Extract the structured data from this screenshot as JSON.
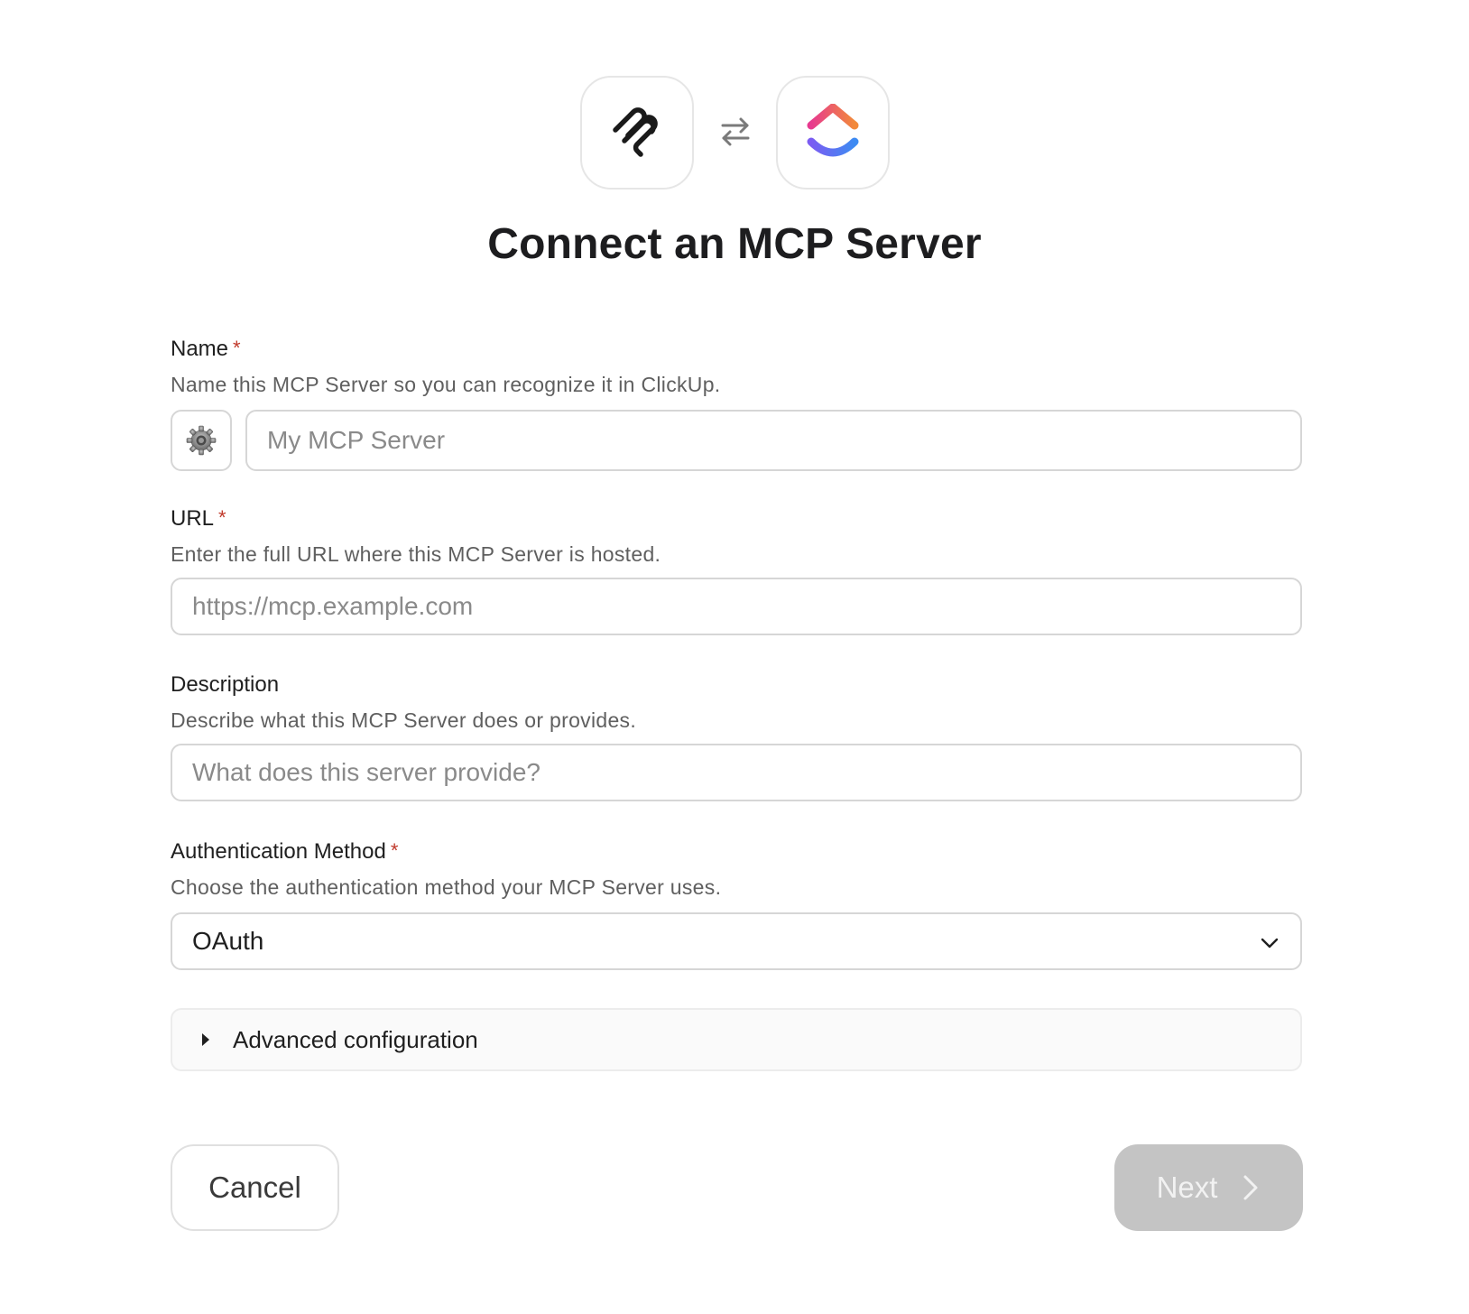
{
  "header": {
    "title": "Connect an MCP Server",
    "left_logo_icon": "mcp-logo-icon",
    "swap_icon": "swap-arrows-icon",
    "right_logo_icon": "clickup-logo-icon"
  },
  "form": {
    "name": {
      "label": "Name",
      "required_mark": "*",
      "help": "Name this MCP Server so you can recognize it in ClickUp.",
      "icon_picker_icon": "gear-icon",
      "placeholder": "My MCP Server"
    },
    "url": {
      "label": "URL",
      "required_mark": "*",
      "help": "Enter the full URL where this MCP Server is hosted.",
      "placeholder": "https://mcp.example.com"
    },
    "description": {
      "label": "Description",
      "help": "Describe what this MCP Server does or provides.",
      "placeholder": "What does this server provide?"
    },
    "auth": {
      "label": "Authentication Method",
      "required_mark": "*",
      "help": "Choose the authentication method your MCP Server uses.",
      "selected": "OAuth"
    },
    "advanced": {
      "label": "Advanced configuration"
    }
  },
  "actions": {
    "cancel_label": "Cancel",
    "next_label": "Next"
  },
  "colors": {
    "required": "#c0392b",
    "next_disabled_bg": "#c4c4c4",
    "clickup_pink": "#e73a8f",
    "clickup_orange": "#f28a3a",
    "clickup_blue": "#3d8bf2",
    "clickup_purple": "#7b5cf2"
  }
}
